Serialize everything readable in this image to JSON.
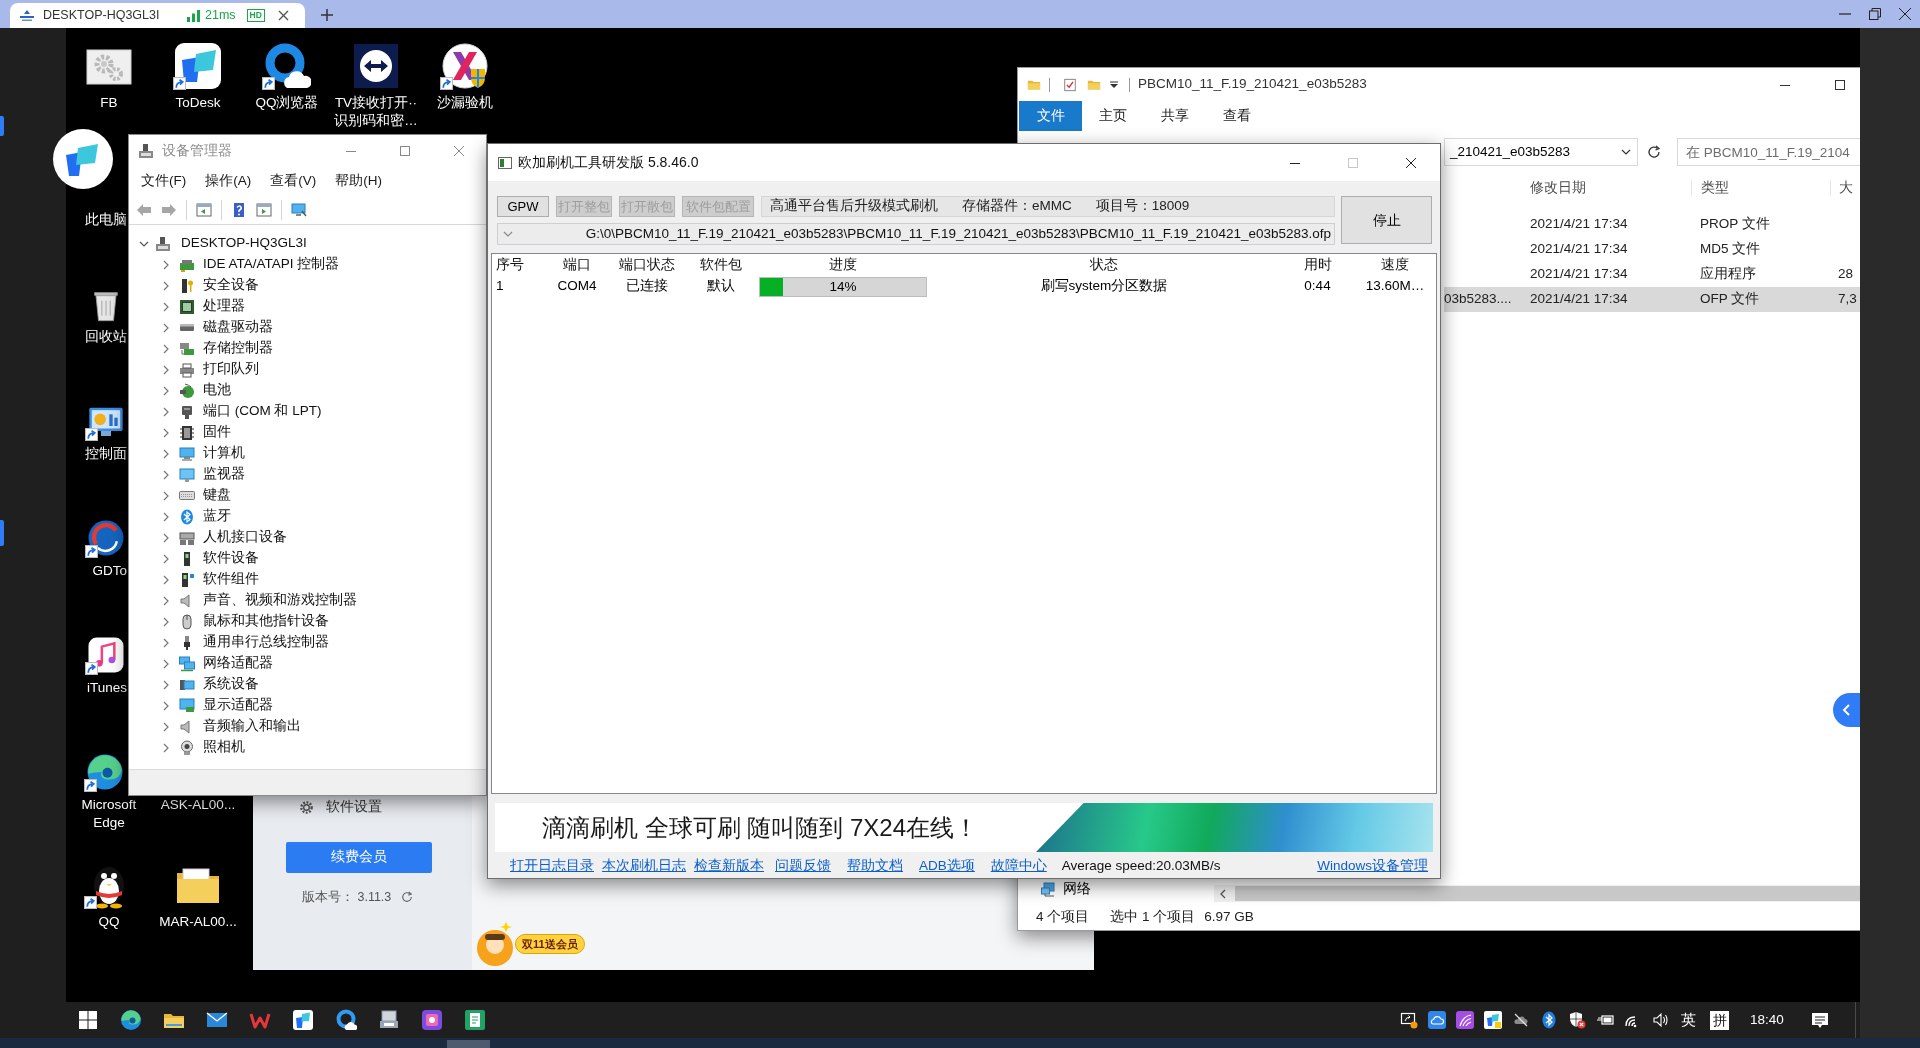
{
  "browser": {
    "tab": {
      "title": "DESKTOP-HQ3GL3I",
      "latency": "21ms",
      "quality": "HD"
    }
  },
  "desktop_icons": [
    {
      "label": "FB",
      "kind": "gears",
      "shortcut": false
    },
    {
      "label": "ToDesk",
      "kind": "tiles",
      "shortcut": true
    },
    {
      "label": "QQ浏览器",
      "kind": "ring",
      "shortcut": true
    },
    {
      "label": "TV接收打开··识别码和密…",
      "kind": "arrows",
      "shortcut": false
    },
    {
      "label": "沙漏验机",
      "kind": "hourglass",
      "shortcut": true
    },
    {
      "label": "此电脑",
      "shortcut": false
    },
    {
      "label": "回收站",
      "kind": "bin",
      "shortcut": false
    },
    {
      "label": "控制面",
      "kind": "panel",
      "shortcut": true
    },
    {
      "label": "GDTo",
      "kind": "gdisc",
      "shortcut": true
    },
    {
      "label": "iTunes",
      "kind": "note",
      "shortcut": true
    },
    {
      "label": "Microsoft Edge",
      "kind": "edge",
      "shortcut": true
    },
    {
      "label": "ASK-AL00...",
      "shortcut": false
    },
    {
      "label": "QQ",
      "kind": "penguin",
      "shortcut": true
    },
    {
      "label": "MAR-AL00...",
      "kind": "folder",
      "shortcut": false
    }
  ],
  "device_manager": {
    "title": "设备管理器",
    "menu": [
      "文件(F)",
      "操作(A)",
      "查看(V)",
      "帮助(H)"
    ],
    "toolbar": [
      [
        {
          "kind": "back",
          "disabled": true
        },
        {
          "kind": "forward",
          "disabled": true
        }
      ],
      [
        {
          "kind": "tree",
          "disabled": false
        }
      ],
      [
        {
          "kind": "help",
          "disabled": false
        },
        {
          "kind": "pane",
          "disabled": false
        }
      ],
      [
        {
          "kind": "scan",
          "disabled": false
        }
      ]
    ],
    "tree": {
      "label": "DESKTOP-HQ3GL3I",
      "kind": "host",
      "expanded": true,
      "children": [
        {
          "label": "IDE ATA/ATAPI 控制器",
          "kind": "ide",
          "expanded": false
        },
        {
          "label": "安全设备",
          "kind": "key",
          "expanded": false
        },
        {
          "label": "处理器",
          "kind": "cpu",
          "expanded": false
        },
        {
          "label": "磁盘驱动器",
          "kind": "disk",
          "expanded": false
        },
        {
          "label": "存储控制器",
          "kind": "storage",
          "expanded": false
        },
        {
          "label": "打印队列",
          "kind": "printer",
          "expanded": false
        },
        {
          "label": "电池",
          "kind": "battery",
          "expanded": false
        },
        {
          "label": "端口 (COM 和 LPT)",
          "kind": "port",
          "expanded": false
        },
        {
          "label": "固件",
          "kind": "firmware",
          "expanded": false
        },
        {
          "label": "计算机",
          "kind": "computer",
          "expanded": false
        },
        {
          "label": "监视器",
          "kind": "monitor",
          "expanded": false
        },
        {
          "label": "键盘",
          "kind": "keyboard",
          "expanded": false
        },
        {
          "label": "蓝牙",
          "kind": "bluetooth",
          "expanded": false
        },
        {
          "label": "人机接口设备",
          "kind": "hid",
          "expanded": false
        },
        {
          "label": "软件设备",
          "kind": "software",
          "expanded": false
        },
        {
          "label": "软件组件",
          "kind": "component",
          "expanded": false
        },
        {
          "label": "声音、视频和游戏控制器",
          "kind": "sound",
          "expanded": false
        },
        {
          "label": "鼠标和其他指针设备",
          "kind": "mouse",
          "expanded": false
        },
        {
          "label": "通用串行总线控制器",
          "kind": "usb",
          "expanded": false
        },
        {
          "label": "网络适配器",
          "kind": "network",
          "expanded": false
        },
        {
          "label": "系统设备",
          "kind": "system",
          "expanded": false
        },
        {
          "label": "显示适配器",
          "kind": "display",
          "expanded": false
        },
        {
          "label": "音频输入和输出",
          "kind": "audio",
          "expanded": false
        },
        {
          "label": "照相机",
          "kind": "camera",
          "expanded": false
        }
      ]
    }
  },
  "flash_tool": {
    "title": "欧加刷机工具研发版 5.8.46.0",
    "maximize_disabled": true,
    "buttons": [
      {
        "label": "GPW",
        "disabled": false
      },
      {
        "label": "打开整包",
        "disabled": true
      },
      {
        "label": "打开散包",
        "disabled": true
      },
      {
        "label": "软件包配置",
        "disabled": true
      }
    ],
    "info": [
      "高通平台售后升级模式刷机",
      "存储器件：eMMC",
      "项目号：18009"
    ],
    "file_path": "G:\\0\\PBCM10_11_F.19_210421_e03b5283\\PBCM10_11_F.19_210421_e03b5283\\PBCM10_11_F.19_210421_e03b5283.ofp",
    "stop_button": "停止",
    "table": {
      "columns": [
        "序号",
        "端口",
        "端口状态",
        "软件包",
        "进度",
        "状态",
        "用时",
        "速度"
      ],
      "rows": [
        {
          "index": "1",
          "port": "COM4",
          "port_status": "已连接",
          "package": "默认",
          "progress": {
            "level": 0.14,
            "label": "14%"
          },
          "status": "刷写system分区数据",
          "elapsed": "0:44",
          "speed": "13.60M…"
        }
      ]
    },
    "banner": "滴滴刷机 全球可刷 随叫随到 7X24在线！",
    "links": [
      "打开日志目录",
      "本次刷机日志",
      "检查新版本",
      "问题反馈",
      "帮助文档",
      "ADB选项",
      "故障中心"
    ],
    "average_speed": "Average speed:20.03MB/s",
    "device_manager_link": "Windows设备管理"
  },
  "explorer": {
    "title": "PBCM10_11_F.19_210421_e03b5283",
    "ribbon_tabs": [
      {
        "label": "文件",
        "kind": "menu"
      },
      {
        "label": "主页",
        "kind": "tab"
      },
      {
        "label": "共享",
        "kind": "tab"
      },
      {
        "label": "查看",
        "kind": "tab"
      }
    ],
    "address": "_210421_e03b5283",
    "search_placeholder": "在 PBCM10_11_F.19_2104",
    "columns": [
      "修改日期",
      "类型",
      "大"
    ],
    "rows": [
      {
        "date": "2021/4/21 17:34",
        "type": "PROP 文件",
        "selected": false
      },
      {
        "date": "2021/4/21 17:34",
        "type": "MD5 文件",
        "selected": false
      },
      {
        "date": "2021/4/21 17:34",
        "type": "应用程序",
        "size": "28",
        "selected": false
      },
      {
        "name": "03b5283....",
        "date": "2021/4/21 17:34",
        "type": "OFP 文件",
        "size": "7,3",
        "selected": true
      }
    ],
    "nav_items": [
      "网络"
    ],
    "status": [
      "4 个项目",
      "选中 1 个项目",
      "6.97 GB"
    ]
  },
  "todesk_window": {
    "settings": "软件设置",
    "renew_button": "续费会员",
    "version": "版本号： 3.11.3",
    "promo": "双11送会员"
  },
  "taskbar": {
    "apps": [
      {
        "kind": "start"
      },
      {
        "kind": "browser"
      },
      {
        "kind": "files"
      },
      {
        "kind": "mail"
      },
      {
        "kind": "office"
      },
      {
        "kind": "remote"
      },
      {
        "kind": "ring"
      },
      {
        "kind": "devices"
      },
      {
        "kind": "media"
      },
      {
        "kind": "sheet"
      }
    ],
    "tray": [
      {
        "kind": "screen"
      },
      {
        "kind": "cloud"
      },
      {
        "kind": "stripes"
      },
      {
        "kind": "remote"
      },
      {
        "kind": "cloudoff"
      },
      {
        "kind": "bluetooth"
      },
      {
        "kind": "shield"
      },
      {
        "kind": "power"
      },
      {
        "kind": "wifi"
      },
      {
        "kind": "volume"
      }
    ],
    "input_language": "英",
    "ime_mode": "拼",
    "clock": "18:40"
  }
}
